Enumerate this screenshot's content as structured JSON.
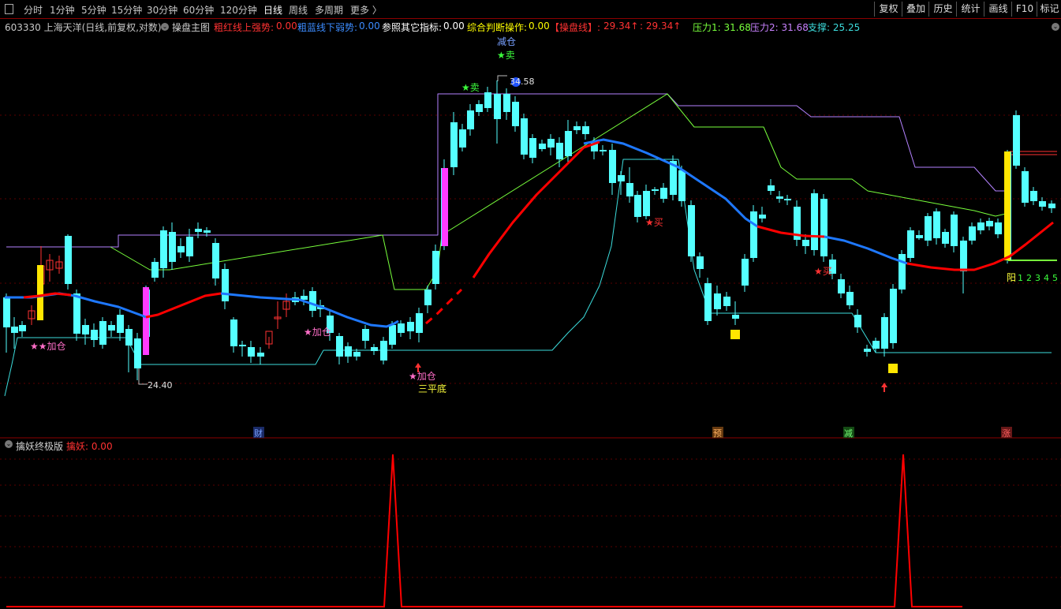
{
  "toolbar": {
    "periods": [
      "分时",
      "1分钟",
      "5分钟",
      "15分钟",
      "30分钟",
      "60分钟",
      "120分钟",
      "日线",
      "周线",
      "多周期",
      "更多 〉"
    ],
    "active_period": "日线",
    "right_buttons": [
      "复权",
      "叠加",
      "历史",
      "统计",
      "画线",
      "F10",
      "标记"
    ]
  },
  "info": {
    "stock": "603330 上海天洋(日线,前复权,对数)",
    "indicator_name": "操盘主图",
    "red_strong_label": "粗红线上强势:",
    "red_strong_value": "0.00",
    "blue_weak_label": "粗蓝线下弱势:",
    "blue_weak_value": "0.00",
    "ref_label": "参照其它指标:",
    "ref_value": "0.00",
    "judge_label": "综合判断操作:",
    "judge_value": "0.00",
    "line_label": "【操盘线】:",
    "line_value1": "29.34↑",
    "line_value2": ": 29.34↑",
    "pressure1": "压力1: 31.68",
    "pressure2": "压力2: 31.68",
    "support": "支撑: 25.25"
  },
  "annotations": {
    "reduce_top": "减仓",
    "sell_top": "★卖",
    "sell_left": "★卖",
    "high_price": "34.58",
    "low_price": "24.40",
    "add1": "★★加仓",
    "add2": "★加仓",
    "add3": "★加仓",
    "triple_bottom": "三平底",
    "buy1": "★买",
    "buy2": "★买",
    "yang": "阳",
    "nums": [
      "1",
      "2",
      "3",
      "4",
      "5"
    ],
    "events": [
      "财",
      "预",
      "减",
      "涨"
    ]
  },
  "lower": {
    "title": "擒妖终极版",
    "label": "擒妖: 0.00"
  },
  "colors": {
    "up": "#ff3232",
    "down": "#54ffff",
    "red_line": "#ff0000",
    "blue_line": "#1e78ff",
    "purple": "#b482ff",
    "green_line": "#78ff3c",
    "cyan_line": "#3cdcdc",
    "magenta": "#ff3cff",
    "yellow": "#ffe600"
  }
}
